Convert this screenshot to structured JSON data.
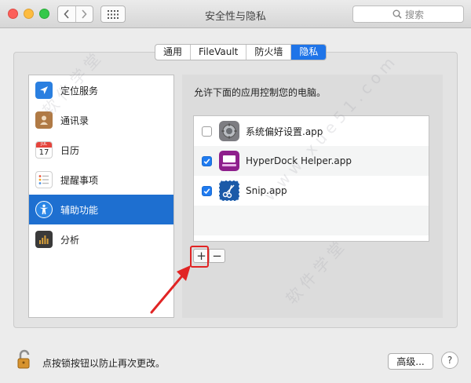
{
  "window": {
    "title": "安全性与隐私",
    "search_placeholder": "搜索"
  },
  "tabs": [
    {
      "label": "通用",
      "active": false
    },
    {
      "label": "FileVault",
      "active": false
    },
    {
      "label": "防火墙",
      "active": false
    },
    {
      "label": "隐私",
      "active": true
    }
  ],
  "sidebar": {
    "items": [
      {
        "label": "定位服务",
        "icon": "location-arrow-icon",
        "selected": false
      },
      {
        "label": "通讯录",
        "icon": "contacts-book-icon",
        "selected": false
      },
      {
        "label": "日历",
        "icon": "calendar-icon",
        "calendar_month": "JUL",
        "calendar_day": "17",
        "selected": false
      },
      {
        "label": "提醒事项",
        "icon": "reminders-icon",
        "selected": false
      },
      {
        "label": "辅助功能",
        "icon": "accessibility-icon",
        "selected": true
      },
      {
        "label": "分析",
        "icon": "analytics-icon",
        "selected": false
      }
    ]
  },
  "main": {
    "heading": "允许下面的应用控制您的电脑。",
    "apps": [
      {
        "name": "系统偏好设置.app",
        "checked": false,
        "icon": "system-preferences-gear-icon"
      },
      {
        "name": "HyperDock Helper.app",
        "checked": true,
        "icon": "hyperdock-icon"
      },
      {
        "name": "Snip.app",
        "checked": true,
        "icon": "snip-scissors-icon"
      }
    ],
    "add_label": "+",
    "remove_label": "−"
  },
  "footer": {
    "lock_text": "点按锁按钮以防止再次更改。",
    "advanced_label": "高级...",
    "help_label": "?"
  },
  "colors": {
    "accent": "#1f74e8",
    "selection": "#1e6fd0",
    "annotation": "#e12424"
  }
}
